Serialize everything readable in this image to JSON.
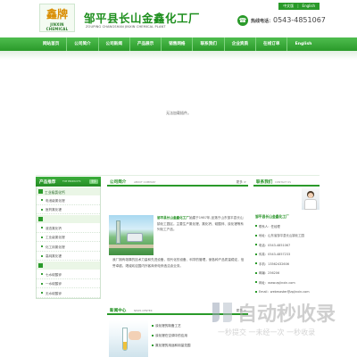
{
  "header": {
    "logo_glyph": "鑫牌",
    "logo_en": "JINXIN CHEMICAL",
    "company_cn": "邹平县长山金鑫化工厂",
    "company_en": "ZOUPING CHANGSHAN JINXIN CHEMICAL PLANT",
    "lang_cn": "中文版",
    "lang_en": "English",
    "phone_label": "热线电话：",
    "phone_number": "0543-4851067"
  },
  "nav": {
    "items": [
      "网站首页",
      "公司简介",
      "公司新闻",
      "产品展示",
      "销售网络",
      "联系我们",
      "企业资质",
      "在线订单",
      "English"
    ]
  },
  "banner": {
    "message": "无法加载插件。"
  },
  "products": {
    "title_cn": "产品推荐",
    "title_en": "TOP PRODUCTS",
    "more": "更多",
    "items": [
      {
        "label": "工业级氯化钙",
        "type": "main"
      },
      {
        "label": "电池级氯化锂",
        "type": "sub"
      },
      {
        "label": "医药氯化锂",
        "type": "sub"
      },
      {
        "label": "",
        "type": "main"
      },
      {
        "label": "液态氯化钙",
        "type": "sub"
      },
      {
        "label": "工业级氯化锂",
        "type": "sub"
      },
      {
        "label": "化工用氯化锂",
        "type": "sub"
      },
      {
        "label": "高纯氯化锂",
        "type": "sub"
      },
      {
        "label": "",
        "type": "main"
      },
      {
        "label": "七水硫酸锌",
        "type": "sub"
      },
      {
        "label": "一水硫酸锌",
        "type": "sub"
      },
      {
        "label": "无水硫酸锌",
        "type": "sub"
      }
    ]
  },
  "about": {
    "title_cn": "公司简介",
    "title_en": "ABOUT COMPANY",
    "more": "更多 >",
    "company": "邹平县长山金鑫化工厂",
    "para1": "始建于1987年,坐落于山东邹平县长山镇化工园区。主要生产氯化锂、氯化钙、硫酸锌、溴化锂等系列化工产品。",
    "para2": "我厂拥有雄厚的技术力量和先进设备，现代化的设备、科学的管理，使各种产品质量稳定，信誉卓越。竭诚欢迎国内外客商来电来函洽谈业务。"
  },
  "news": {
    "title_cn": "新闻中心",
    "title_en": "NEWS CENTER",
    "more": "更多 >",
    "items": [
      "溴化锂的制备工艺",
      "溴化锂在空调中的应用",
      "氯化锂的用途和用量范围"
    ]
  },
  "contact": {
    "title_cn": "联系我们",
    "title_en": "CONTACT US",
    "company": "邹平县长山金鑫化工厂",
    "rows": [
      "联系人：任经理",
      "地址：山东省邹平县长山镇化工园",
      "电话：0543-4851067",
      "传真：0543-4857233",
      "手机：13562432606",
      "邮编：256206",
      "网址：www.zpjinxin.com",
      "Email：webmaster@zpjinxin.com"
    ]
  },
  "watermark": {
    "text": "自动秒收录",
    "sub": "一秒提交 一未经一次 一秒收录"
  },
  "colors": {
    "accent": "#2a9a2a",
    "nav_bg": "#3aaa3a",
    "light": "#eaf6e6"
  }
}
